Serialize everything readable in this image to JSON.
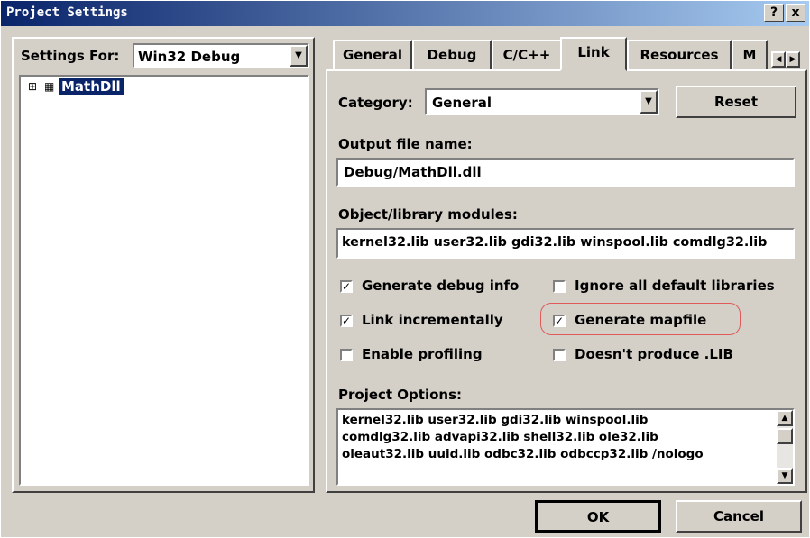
{
  "window": {
    "title": "Project Settings",
    "help_btn": "?",
    "close_btn": "x"
  },
  "settings_for": {
    "label": "Settings For:",
    "value": "Win32 Debug"
  },
  "tree": {
    "expander": "⊞",
    "item": "MathDll"
  },
  "tabs": [
    "General",
    "Debug",
    "C/C++",
    "Link",
    "Resources",
    "M"
  ],
  "active_tab": "Link",
  "category": {
    "label": "Category:",
    "value": "General",
    "reset": "Reset"
  },
  "output": {
    "label": "Output file name:",
    "value": "Debug/MathDll.dll"
  },
  "modules": {
    "label": "Object/library modules:",
    "value": "kernel32.lib user32.lib gdi32.lib winspool.lib comdlg32.lib"
  },
  "checks": {
    "debug_info": {
      "label": "Generate debug info",
      "checked": true
    },
    "ignore_libs": {
      "label": "Ignore all default libraries",
      "checked": false
    },
    "incremental": {
      "label": "Link incrementally",
      "checked": true
    },
    "mapfile": {
      "label": "Generate mapfile",
      "checked": true
    },
    "profiling": {
      "label": "Enable profiling",
      "checked": false
    },
    "no_lib": {
      "label": "Doesn't produce .LIB",
      "checked": false
    }
  },
  "project_options": {
    "label": "Project Options:",
    "lines": [
      "kernel32.lib user32.lib gdi32.lib winspool.lib",
      "comdlg32.lib advapi32.lib shell32.lib ole32.lib",
      "oleaut32.lib uuid.lib odbc32.lib odbccp32.lib /nologo"
    ]
  },
  "buttons": {
    "ok": "OK",
    "cancel": "Cancel"
  },
  "colors": {
    "highlight": "#0a246a",
    "titlebar_end": "#a6caf0",
    "callout": "#e05a5a"
  }
}
